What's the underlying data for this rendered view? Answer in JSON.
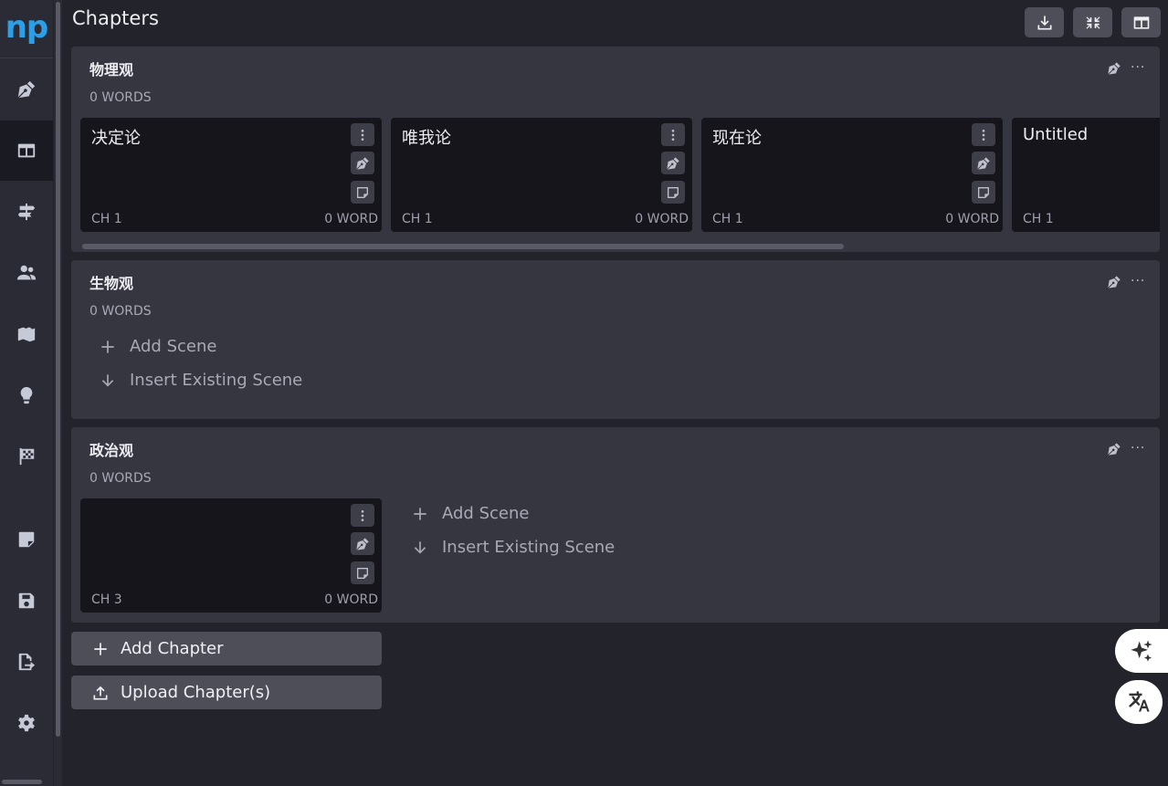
{
  "app": {
    "logo": "np",
    "title": "Chapters"
  },
  "sidebar": {
    "items": [
      {
        "icon": "pen-nib-icon"
      },
      {
        "icon": "columns-icon",
        "active": true
      },
      {
        "icon": "signpost-icon"
      },
      {
        "icon": "users-icon"
      },
      {
        "icon": "map-icon"
      },
      {
        "icon": "lightbulb-icon"
      },
      {
        "icon": "checkered-flag-icon"
      },
      {
        "icon": "note-icon"
      },
      {
        "icon": "save-icon"
      },
      {
        "icon": "export-icon"
      },
      {
        "icon": "gear-icon"
      }
    ]
  },
  "header": {
    "buttons": [
      {
        "icon": "download-icon"
      },
      {
        "icon": "collapse-icon"
      },
      {
        "icon": "columns-icon"
      }
    ]
  },
  "chapters": [
    {
      "title": "物理观",
      "words": "0 WORDS",
      "scenes": [
        {
          "title": "决定论",
          "ch": "CH 1",
          "words": "0 WORD"
        },
        {
          "title": "唯我论",
          "ch": "CH 1",
          "words": "0 WORD"
        },
        {
          "title": "现在论",
          "ch": "CH 1",
          "words": "0 WORD"
        },
        {
          "title": "Untitled",
          "ch": "CH 1",
          "words": ""
        }
      ]
    },
    {
      "title": "生物观",
      "words": "0 WORDS",
      "add_scene": "Add Scene",
      "insert_scene": "Insert Existing Scene"
    },
    {
      "title": "政治观",
      "words": "0 WORDS",
      "scenes": [
        {
          "title": "",
          "ch": "CH 3",
          "words": "0 WORD"
        }
      ],
      "add_scene": "Add Scene",
      "insert_scene": "Insert Existing Scene"
    }
  ],
  "actions": {
    "add_chapter": "Add Chapter",
    "upload_chapter": "Upload Chapter(s)"
  },
  "floating": [
    {
      "icon": "sparkle-icon"
    },
    {
      "icon": "translate-icon"
    }
  ],
  "colors": {
    "accent": "#2ba0e8",
    "background": "#23232c",
    "panel": "#363641",
    "card": "#16151c"
  }
}
